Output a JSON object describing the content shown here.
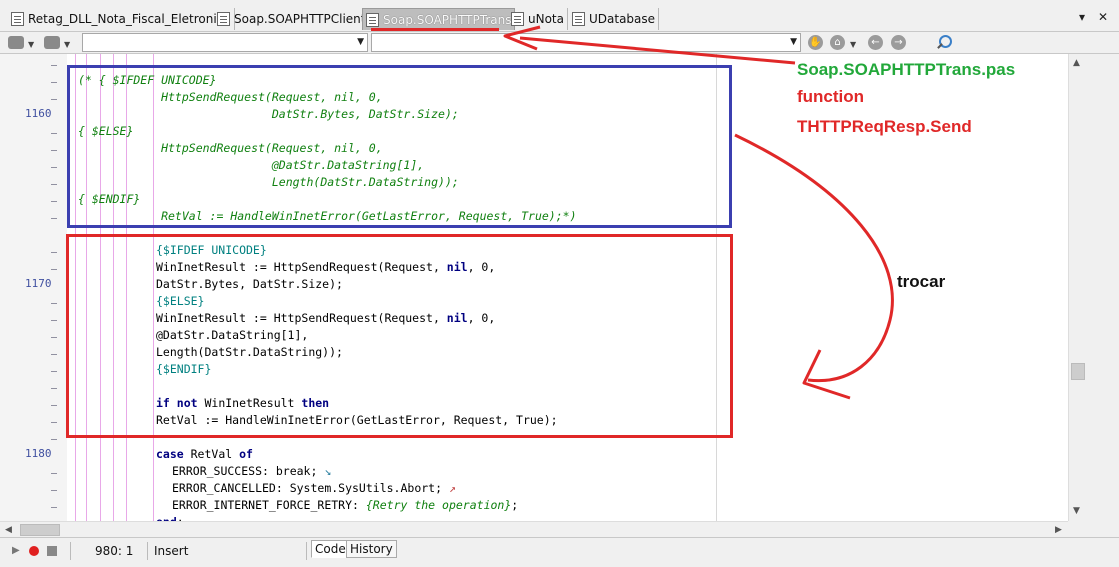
{
  "tabs": [
    {
      "label": "Retag_DLL_Nota_Fiscal_Eletronica"
    },
    {
      "label": "Soap.SOAPHTTPClient"
    },
    {
      "label": "Soap.SOAPHTTPTrans"
    },
    {
      "label": "uNota"
    },
    {
      "label": "UDatabase"
    }
  ],
  "tab_controls": {
    "dropdown": "▾",
    "close": "✕"
  },
  "line_numbers": [
    "1160",
    "1170",
    "1180"
  ],
  "code": {
    "l1": "(* { $IFDEF UNICODE}",
    "l2": "            HttpSendRequest(Request, nil, 0,",
    "l3": "                            DatStr.Bytes, DatStr.Size);",
    "l4": "{ $ELSE}",
    "l5": "            HttpSendRequest(Request, nil, 0,",
    "l6": "                            @DatStr.DataString[1],",
    "l7": "                            Length(DatStr.DataString));",
    "l8": "{ $ENDIF}",
    "l9": "            RetVal := HandleWinInetError(GetLastError, Request, True);*)",
    "l10": "{$IFDEF UNICODE}",
    "l11a": "WinInetResult := HttpSendRequest(Request, ",
    "l11kw": "nil",
    "l11b": ", 0,",
    "l12": "DatStr.Bytes, DatStr.Size);",
    "l13": "{$ELSE}",
    "l14a": "WinInetResult := HttpSendRequest(Request, ",
    "l14kw": "nil",
    "l14b": ", 0,",
    "l15": "@DatStr.DataString[1],",
    "l16": "Length(DatStr.DataString));",
    "l17": "{$ENDIF}",
    "l18kw1": "if not",
    "l18a": " WinInetResult ",
    "l18kw2": "then",
    "l19": "RetVal := HandleWinInetError(GetLastError, Request, True);",
    "l20kw1": "case",
    "l20a": " RetVal ",
    "l20kw2": "of",
    "l21": "ERROR_SUCCESS: break;",
    "l22": "ERROR_CANCELLED: System.SysUtils.Abort;",
    "l23a": "ERROR_INTERNET_FORCE_RETRY: ",
    "l23cm": "{Retry the operation}",
    "l23b": ";",
    "l24kw": "end",
    "l24b": ";"
  },
  "status": {
    "position": "980:  1",
    "mode": "Insert",
    "tab_code": "Code",
    "tab_history": "History"
  },
  "annotations": {
    "file": "Soap.SOAPHTTPTrans.pas",
    "function_label": "function",
    "method": "THTTPReqResp.Send",
    "replace": "trocar"
  },
  "colors": {
    "annotation_green": "#22a83a",
    "annotation_red": "#e02828",
    "box_blue": "#3b3fb0"
  }
}
